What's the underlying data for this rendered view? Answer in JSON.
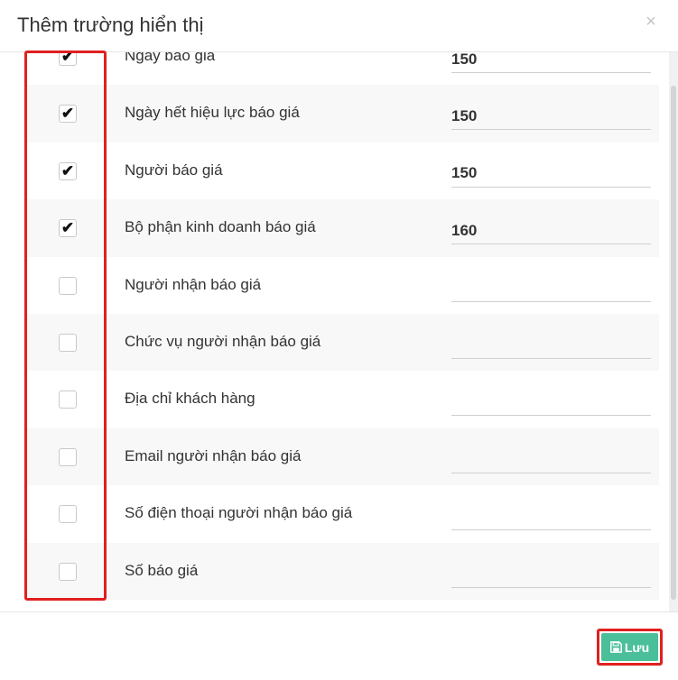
{
  "modal": {
    "title": "Thêm trường hiển thị",
    "close_label": "×",
    "save_label": "Lưu",
    "save_icon": "floppy-disk-icon",
    "colors": {
      "save_button": "#4bbf9a",
      "highlight": "#e02020"
    }
  },
  "fields": [
    {
      "label": "Ngày báo giá",
      "checked": true,
      "width": "150"
    },
    {
      "label": "Ngày hết hiệu lực báo giá",
      "checked": true,
      "width": "150"
    },
    {
      "label": "Người báo giá",
      "checked": true,
      "width": "150"
    },
    {
      "label": "Bộ phận kinh doanh báo giá",
      "checked": true,
      "width": "160"
    },
    {
      "label": "Người nhận báo giá",
      "checked": false,
      "width": ""
    },
    {
      "label": "Chức vụ người nhận báo giá",
      "checked": false,
      "width": ""
    },
    {
      "label": "Địa chỉ khách hàng",
      "checked": false,
      "width": ""
    },
    {
      "label": "Email người nhận báo giá",
      "checked": false,
      "width": ""
    },
    {
      "label": "Số điện thoại người nhận báo giá",
      "checked": false,
      "width": ""
    },
    {
      "label": "Số báo giá",
      "checked": false,
      "width": ""
    }
  ]
}
